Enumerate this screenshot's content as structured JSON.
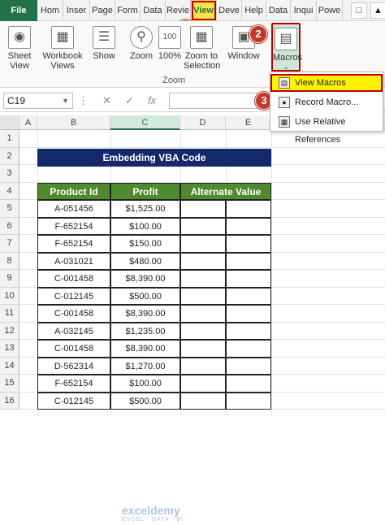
{
  "ribbon_tabs": {
    "file": "File",
    "home": "Hom",
    "insert": "Inser",
    "page": "Page",
    "formulas": "Form",
    "data": "Data",
    "review": "Revie",
    "view": "View",
    "developer": "Deve",
    "help": "Help",
    "data2": "Data",
    "inquire": "Inqui",
    "power": "Powe"
  },
  "ribbon": {
    "sheet_view": "Sheet View",
    "workbook_views": "Workbook Views",
    "show": "Show",
    "zoom": "Zoom",
    "zoom100": "100%",
    "zoom_selection": "Zoom to Selection",
    "zoom_group": "Zoom",
    "window": "Window",
    "macros": "Macros"
  },
  "badges": [
    "1",
    "2",
    "3"
  ],
  "menu": {
    "view_macros": "View Macros",
    "record_macro": "Record Macro...",
    "relative_refs": "Use Relative References"
  },
  "formula_bar": {
    "name_box": "C19",
    "fx": "fx"
  },
  "columns": [
    "A",
    "B",
    "C",
    "D",
    "E"
  ],
  "rows": [
    "1",
    "2",
    "3",
    "4",
    "5",
    "6",
    "7",
    "8",
    "9",
    "10",
    "11",
    "12",
    "13",
    "14",
    "15",
    "16"
  ],
  "sheet": {
    "title": "Embedding VBA Code",
    "headers": [
      "Product Id",
      "Profit",
      "Alternate Value"
    ],
    "rows": [
      [
        "A-051456",
        "$1,525.00"
      ],
      [
        "F-652154",
        "$100.00"
      ],
      [
        "F-652154",
        "$150.00"
      ],
      [
        "A-031021",
        "$480.00"
      ],
      [
        "C-001458",
        "$8,390.00"
      ],
      [
        "C-012145",
        "$500.00"
      ],
      [
        "C-001458",
        "$8,390.00"
      ],
      [
        "A-032145",
        "$1,235.00"
      ],
      [
        "C-001458",
        "$8,390.00"
      ],
      [
        "D-562314",
        "$1,270.00"
      ],
      [
        "F-652154",
        "$100.00"
      ],
      [
        "C-012145",
        "$500.00"
      ]
    ]
  },
  "watermark": {
    "name": "exceldemy",
    "tagline": "EXCEL · DATA · BI"
  },
  "colors": {
    "excel_green": "#217346",
    "header_navy": "#14296b",
    "table_green": "#4f8a2e",
    "highlight": "#fef200",
    "badge_red": "#c0392b"
  }
}
